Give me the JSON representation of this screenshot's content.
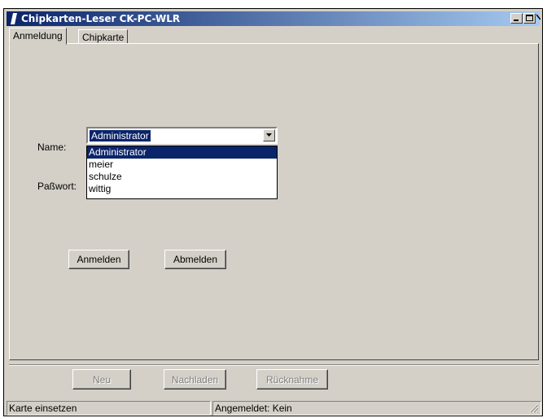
{
  "window": {
    "title": "Chipkarten-Leser CK-PC-WLR",
    "colors": {
      "title_start": "#0a246a",
      "title_end": "#a6caf0",
      "face": "#d4d0c8",
      "selection": "#0a246a"
    }
  },
  "tabs": [
    {
      "label": "Anmeldung",
      "active": true
    },
    {
      "label": "Chipkarte",
      "active": false
    }
  ],
  "login": {
    "name_label": "Name:",
    "password_label": "Paßwort:",
    "name_value": "Administrator",
    "options": [
      "Administrator",
      "meier",
      "schulze",
      "wittig"
    ],
    "login_button": "Anmelden",
    "logout_button": "Abmelden"
  },
  "toolbar": {
    "new_label": "Neu",
    "reload_label": "Nachladen",
    "revoke_label": "Rücknahme"
  },
  "status": {
    "left": "Karte einsetzen",
    "right": "Angemeldet: Kein"
  }
}
